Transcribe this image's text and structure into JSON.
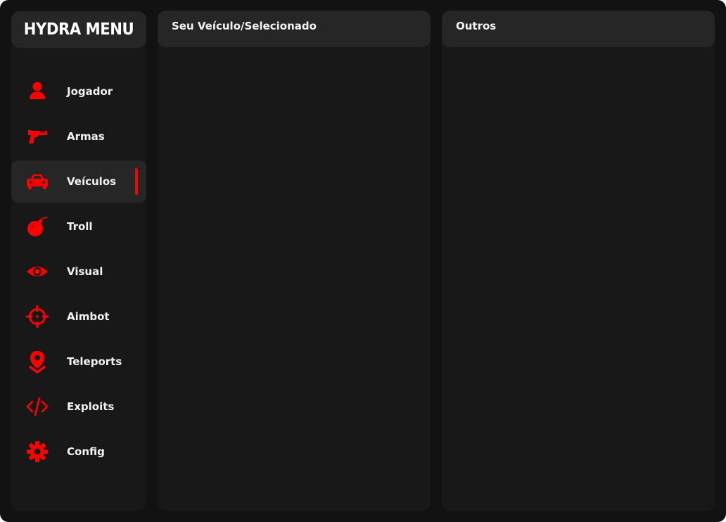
{
  "app": {
    "title": "HYDRA MENU"
  },
  "colors": {
    "accent": "#ff0000",
    "background": "#121212",
    "panel": "#181818",
    "panel_header": "#262626",
    "text": "#f2f2f2"
  },
  "sidebar": {
    "active_index": 2,
    "items": [
      {
        "label": "Jogador",
        "icon": "user-icon"
      },
      {
        "label": "Armas",
        "icon": "pistol-icon"
      },
      {
        "label": "Veículos",
        "icon": "car-icon"
      },
      {
        "label": "Troll",
        "icon": "bomb-icon"
      },
      {
        "label": "Visual",
        "icon": "eye-icon"
      },
      {
        "label": "Aimbot",
        "icon": "crosshair-icon"
      },
      {
        "label": "Teleports",
        "icon": "map-pin-icon"
      },
      {
        "label": "Exploits",
        "icon": "code-icon"
      },
      {
        "label": "Config",
        "icon": "gear-icon"
      }
    ]
  },
  "panels": {
    "left": {
      "title": "Seu Veículo/Selecionado"
    },
    "right": {
      "title": "Outros"
    }
  }
}
